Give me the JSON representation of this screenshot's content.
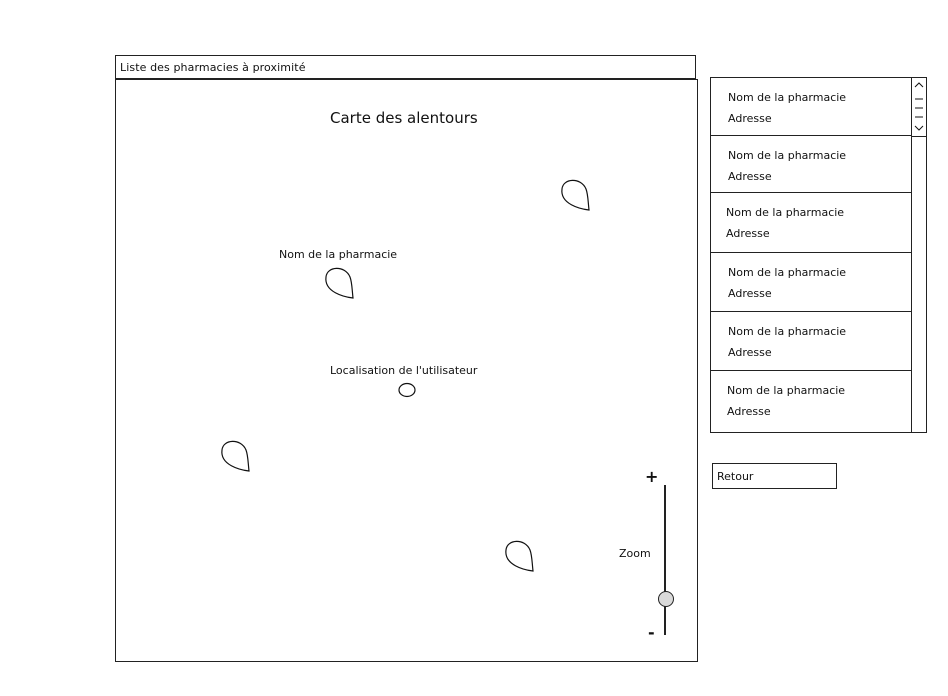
{
  "header": {
    "title": "Liste des pharmacies à proximité"
  },
  "map": {
    "title": "Carte des alentours",
    "pharmacy_label": "Nom de la pharmacie",
    "user_location_label": "Localisation de l'utilisateur",
    "zoom": {
      "plus": "+",
      "minus": "-",
      "label": "Zoom",
      "level": 0.2
    }
  },
  "list": {
    "items": [
      {
        "name": "Nom de la pharmacie",
        "address": "Adresse"
      },
      {
        "name": "Nom de la pharmacie",
        "address": "Adresse"
      },
      {
        "name": "Nom de la pharmacie",
        "address": "Adresse"
      },
      {
        "name": "Nom de la pharmacie",
        "address": "Adresse"
      },
      {
        "name": "Nom de la pharmacie",
        "address": "Adresse"
      },
      {
        "name": "Nom de la pharmacie",
        "address": "Adresse"
      }
    ]
  },
  "buttons": {
    "back_label": "Retour"
  },
  "icons": {
    "pin": "map-pin-icon",
    "user": "user-location-icon",
    "scroll_up": "chevron-up-icon",
    "scroll_down": "chevron-down-icon"
  }
}
